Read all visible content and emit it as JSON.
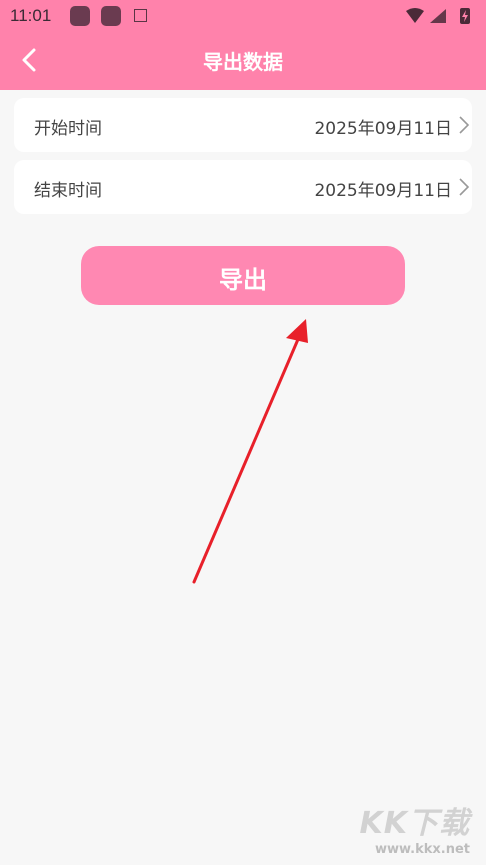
{
  "status_bar": {
    "time": "11:01",
    "left_icons": [
      "app-icon",
      "app-icon",
      "a-icon"
    ],
    "right_icons": [
      "wifi-icon",
      "signal-icon",
      "battery-charging-icon"
    ]
  },
  "header": {
    "title": "导出数据",
    "back_icon": "chevron-left-icon",
    "bg_color": "#ff82ab"
  },
  "rows": [
    {
      "label": "开始时间",
      "value": "2025年09月11日"
    },
    {
      "label": "结束时间",
      "value": "2025年09月11日"
    }
  ],
  "export_button": {
    "label": "导出",
    "color": "#ff88b2"
  },
  "watermark": {
    "big": "KK下载",
    "small": "www.kkx.net"
  }
}
